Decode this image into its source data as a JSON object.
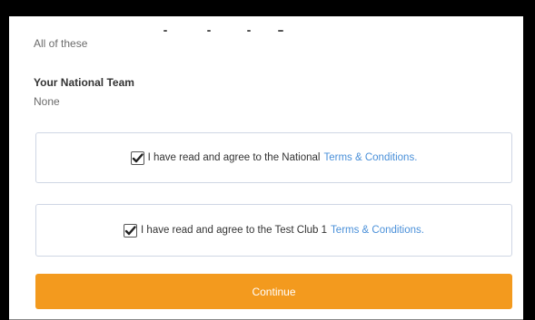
{
  "selection": {
    "summary": "All of these"
  },
  "national_team": {
    "heading": "Your National Team",
    "value": "None"
  },
  "agreements": [
    {
      "text": "I have read and agree to the National",
      "link": "Terms & Conditions.",
      "checked": true
    },
    {
      "text": "I have read and agree to the Test Club 1",
      "link": "Terms & Conditions.",
      "checked": true
    }
  ],
  "actions": {
    "continue_label": "Continue"
  },
  "colors": {
    "accent": "#f39a1e",
    "link": "#4a90d9",
    "border": "#cfd6e4"
  },
  "icons": {
    "checkbox": "checkmark-icon"
  }
}
